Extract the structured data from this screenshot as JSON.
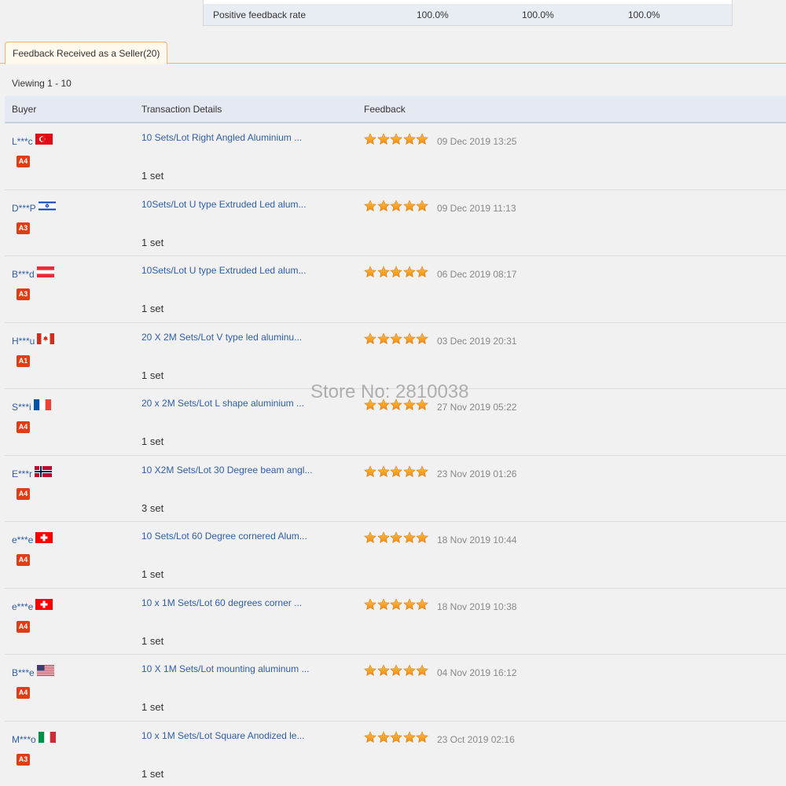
{
  "summary": {
    "label": "Positive feedback rate",
    "values": [
      "100.0%",
      "100.0%",
      "100.0%"
    ]
  },
  "tab": {
    "label": "Feedback Received as a Seller(20)"
  },
  "viewing": "Viewing 1 - 10",
  "columns": {
    "buyer": "Buyer",
    "transaction": "Transaction Details",
    "feedback": "Feedback"
  },
  "watermark": "Store No: 2810038",
  "colors": {
    "link": "#2f5ea8",
    "badge": "#e03d14",
    "star": "#f39a1c",
    "tab_border": "#f2b46b"
  },
  "rows": [
    {
      "buyer": "L***c",
      "flag": "turkey",
      "badge": "A4",
      "item": "10 Sets/Lot Right Angled Aluminium ...",
      "qty": "1 set",
      "rating": 5,
      "date": "09 Dec 2019 13:25"
    },
    {
      "buyer": "D***P",
      "flag": "israel",
      "badge": "A3",
      "item": "10Sets/Lot U type Extruded Led alum...",
      "qty": "1 set",
      "rating": 5,
      "date": "09 Dec 2019 11:13"
    },
    {
      "buyer": "B***d",
      "flag": "austria",
      "badge": "A3",
      "item": "10Sets/Lot U type Extruded Led alum...",
      "qty": "1 set",
      "rating": 5,
      "date": "06 Dec 2019 08:17"
    },
    {
      "buyer": "H***u",
      "flag": "canada",
      "badge": "A1",
      "item": "20 X 2M Sets/Lot V type led aluminu...",
      "qty": "1 set",
      "rating": 5,
      "date": "03 Dec 2019 20:31"
    },
    {
      "buyer": "S***i",
      "flag": "france",
      "badge": "A4",
      "item": "20 x 2M Sets/Lot L shape aluminium ...",
      "qty": "1 set",
      "rating": 5,
      "date": "27 Nov 2019 05:22"
    },
    {
      "buyer": "E***r",
      "flag": "norway",
      "badge": "A4",
      "item": "10 X2M Sets/Lot 30 Degree beam angl...",
      "qty": "3 set",
      "rating": 5,
      "date": "23 Nov 2019 01:26"
    },
    {
      "buyer": "e***e",
      "flag": "switzerland",
      "badge": "A4",
      "item": "10 Sets/Lot 60 Degree cornered Alum...",
      "qty": "1 set",
      "rating": 5,
      "date": "18 Nov 2019 10:44"
    },
    {
      "buyer": "e***e",
      "flag": "switzerland",
      "badge": "A4",
      "item": "10 x 1M Sets/Lot 60 degrees corner ...",
      "qty": "1 set",
      "rating": 5,
      "date": "18 Nov 2019 10:38"
    },
    {
      "buyer": "B***e",
      "flag": "usa",
      "badge": "A4",
      "item": "10 X 1M Sets/Lot mounting aluminum ...",
      "qty": "1 set",
      "rating": 5,
      "date": "04 Nov 2019 16:12"
    },
    {
      "buyer": "M***o",
      "flag": "italy",
      "badge": "A3",
      "item": "10 x 1M Sets/Lot Square Anodized le...",
      "qty": "1 set",
      "rating": 5,
      "date": "23 Oct 2019 02:16"
    }
  ]
}
